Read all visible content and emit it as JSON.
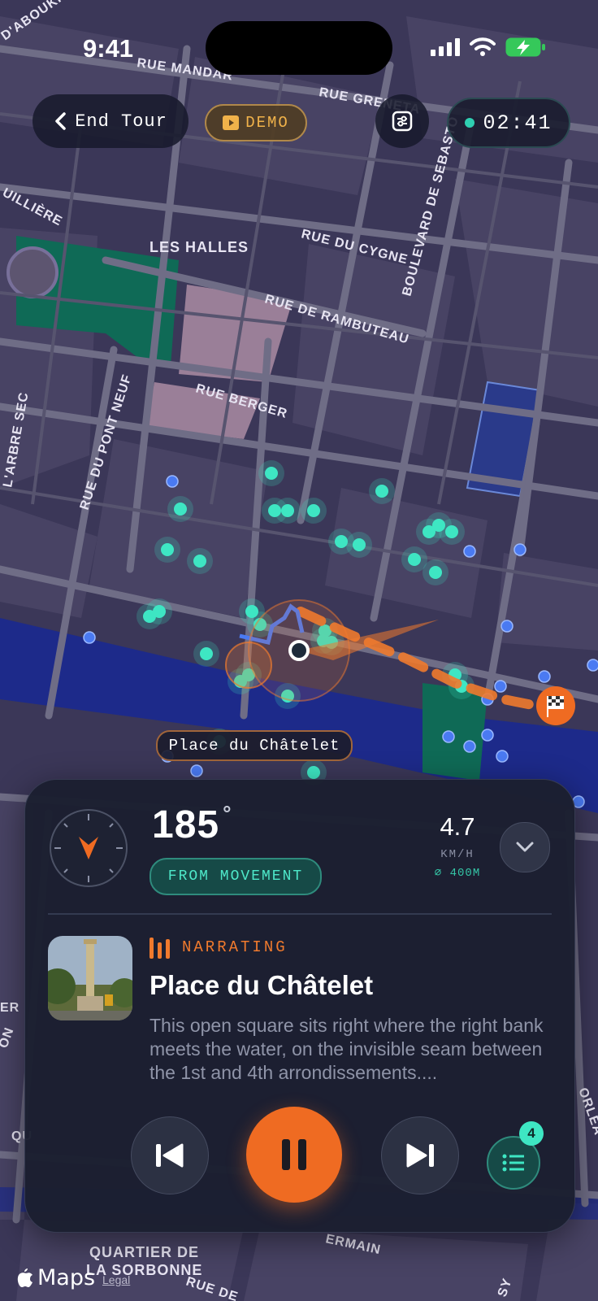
{
  "status_bar": {
    "time": "9:41"
  },
  "top_bar": {
    "end_tour_label": "End Tour",
    "demo_label": "DEMO",
    "timer": "02:41"
  },
  "map": {
    "labels": {
      "rue_mandar": "RUE MANDAR",
      "rue_greneta": "RUE GRENETA",
      "les_halles": "LES HALLES",
      "rue_du_cygne": "RUE DU CYGNE",
      "boulevard_sebastopol": "BOULEVARD DE SEBASTO",
      "rue_de_rambuteau": "RUE DE RAMBUTEAU",
      "rue_berger": "RUE BERGER",
      "rue_du_pont_neuf": "RUE DU PONT NEUF",
      "quartier_latin_1": "QUARTIER DE",
      "quartier_latin_2": "LA SORBONNE",
      "aboukir": "D'ABOUKIR",
      "uilliere": "UILLIÈRE",
      "arbre_sec": "L'ARBRE SEC",
      "rue_de": "RUE DE",
      "ermain": "ERMAIN",
      "orlea": "ORLÉA",
      "sy": "SY",
      "qu": "QU",
      "er": "ER",
      "on": "ON"
    },
    "current_place": "Place du Châtelet"
  },
  "panel": {
    "heading_value": "185",
    "heading_unit": "°",
    "heading_source": "FROM MOVEMENT",
    "speed_value": "4.7",
    "speed_unit": "KM/H",
    "accuracy": "⌀ 400M",
    "status_label": "NARRATING",
    "stop_title": "Place du Châtelet",
    "stop_description": "This open square sits right where the right bank meets the water, on the invisible seam between the 1st and 4th arrondissements....",
    "queue_count": "4"
  },
  "attribution": {
    "maps_label": "Maps",
    "legal_label": "Legal"
  },
  "colors": {
    "accent_orange": "#ef6b22",
    "accent_teal": "#3ee6c3",
    "panel_bg": "#1b1f2f",
    "map_bg": "#3a3656",
    "water": "#1d2a8a",
    "park": "#0e6a55"
  }
}
